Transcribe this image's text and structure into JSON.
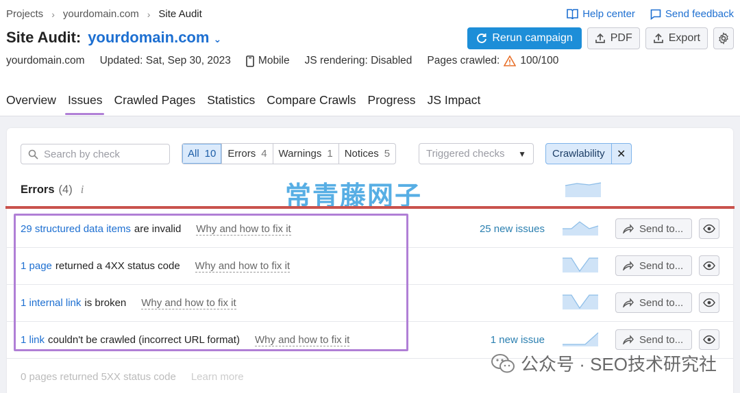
{
  "breadcrumb": [
    "Projects",
    "yourdomain.com",
    "Site Audit"
  ],
  "breadcrumb_sep": "›",
  "top_links": {
    "help": "Help center",
    "feedback": "Send feedback"
  },
  "title": {
    "label": "Site Audit:",
    "domain": "yourdomain.com"
  },
  "actions": {
    "rerun": "Rerun campaign",
    "pdf": "PDF",
    "export": "Export"
  },
  "meta": {
    "domain": "yourdomain.com",
    "updated": "Updated: Sat, Sep 30, 2023",
    "device": "Mobile",
    "js": "JS rendering: Disabled",
    "pages_label": "Pages crawled:",
    "pages_value": "100/100"
  },
  "tabs": [
    "Overview",
    "Issues",
    "Crawled Pages",
    "Statistics",
    "Compare Crawls",
    "Progress",
    "JS Impact"
  ],
  "filters": {
    "search_placeholder": "Search by check",
    "segments": [
      {
        "label": "All",
        "count": "10"
      },
      {
        "label": "Errors",
        "count": "4"
      },
      {
        "label": "Warnings",
        "count": "1"
      },
      {
        "label": "Notices",
        "count": "5"
      }
    ],
    "triggered": "Triggered checks",
    "chip": "Crawlability"
  },
  "errors_header": {
    "label": "Errors",
    "count": "(4)",
    "info": "i"
  },
  "watermark_cn": "常青藤网子",
  "rows": [
    {
      "link": "29 structured data items",
      "rest": "are invalid",
      "why": "Why and how to fix it",
      "new": "25 new issues",
      "send": "Send to..."
    },
    {
      "link": "1 page",
      "rest": "returned a 4XX status code",
      "why": "Why and how to fix it",
      "new": "",
      "send": "Send to..."
    },
    {
      "link": "1 internal link",
      "rest": "is broken",
      "why": "Why and how to fix it",
      "new": "",
      "send": "Send to..."
    },
    {
      "link": "1 link",
      "rest": "couldn't be crawled (incorrect URL format)",
      "why": "Why and how to fix it",
      "new": "1 new issue",
      "send": "Send to..."
    },
    {
      "link": "0 pages returned 5XX status code",
      "rest": "",
      "why": "Learn more",
      "new": "",
      "send": ""
    }
  ],
  "watermark_bottom": "公众号 · SEO技术研究社",
  "colors": {
    "accent": "#1d8ed8",
    "highlight": "#b07fd6",
    "error_line": "#c9524d",
    "link": "#1d6fd1"
  }
}
